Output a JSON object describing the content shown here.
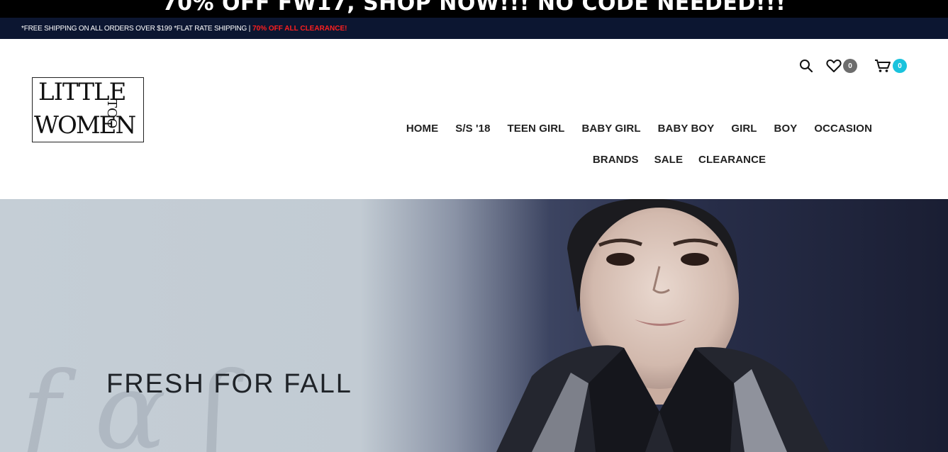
{
  "promo": {
    "text": "70% OFF FW17, SHOP NOW!!! NO CODE NEEDED!!!"
  },
  "shipping": {
    "text": "*FREE SHIPPING ON ALL ORDERS OVER $199 *FLAT RATE SHIPPING |",
    "clearance": "70% OFF ALL CLEARANCE!"
  },
  "logo": {
    "line1": "LITTLE",
    "line2": "WOMEN",
    "side": "TOO"
  },
  "header": {
    "wishlist_count": "0",
    "cart_count": "0"
  },
  "nav": {
    "row1": [
      "HOME",
      "S/S '18",
      "TEEN GIRL",
      "BABY GIRL",
      "BABY BOY",
      "GIRL",
      "BOY",
      "OCCASION"
    ],
    "row2": [
      "BRANDS",
      "SALE",
      "CLEARANCE"
    ]
  },
  "hero": {
    "headline": "FRESH FOR FALL"
  },
  "colors": {
    "promo_bg": "#000000",
    "shipping_bg": "#0c1631",
    "clearance_text": "#ff1f1f",
    "wishlist_badge": "#6d6d6d",
    "cart_badge": "#19c3dd"
  },
  "icons": [
    "search-icon",
    "heart-icon",
    "cart-icon"
  ]
}
